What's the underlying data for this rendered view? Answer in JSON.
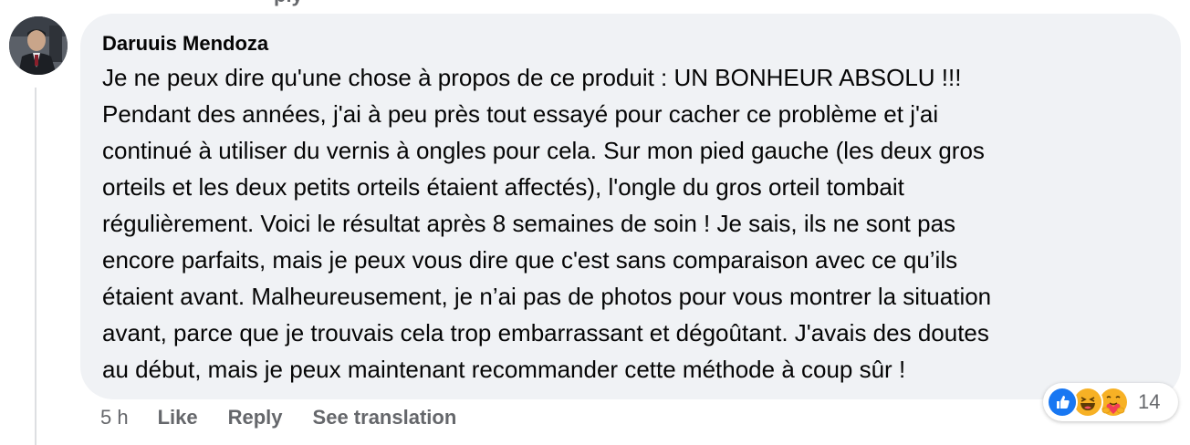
{
  "previous_reply_fragment": "ply",
  "comment": {
    "author": "Daruuis Mendoza",
    "text": "Je ne peux dire qu'une chose à propos de ce produit : UN BONHEUR ABSOLU !!!\nPendant des années, j'ai à peu près tout essayé pour cacher ce problème et j'ai\ncontinué à utiliser du vernis à ongles pour cela. Sur mon pied gauche (les deux gros\norteils et les deux petits orteils étaient affectés), l'ongle du gros orteil tombait\nrégulièrement. Voici le résultat après 8 semaines de soin ! Je sais, ils ne sont pas\nencore parfaits, mais je peux vous dire que c'est sans comparaison avec ce qu’ils\nétaient avant. Malheureusement, je n’ai pas de photos pour vous montrer la situation\navant, parce que je trouvais cela trop embarrassant et dégoûtant. J'avais des doutes\nau début, mais je peux maintenant recommander cette méthode à coup sûr !",
    "timestamp": "5 h",
    "actions": {
      "like": "Like",
      "reply": "Reply",
      "translate": "See translation"
    },
    "reactions": {
      "icons": [
        "like-icon",
        "haha-icon",
        "care-icon"
      ],
      "count": "14"
    }
  },
  "colors": {
    "bubble": "#f0f2f5",
    "meta_text": "#65676b",
    "like_blue": "#1877f2",
    "emoji_yellow": "#f7b125"
  }
}
